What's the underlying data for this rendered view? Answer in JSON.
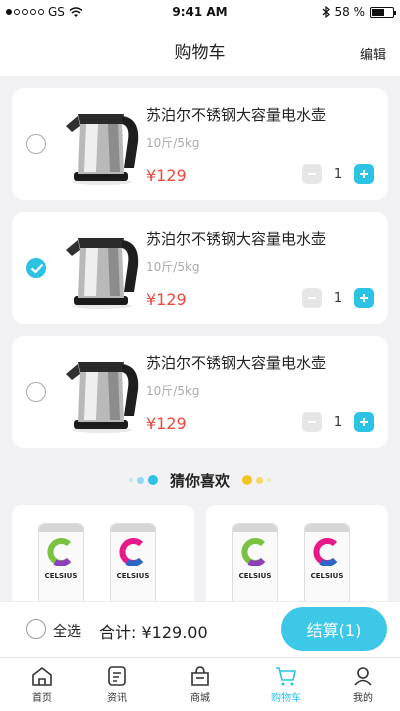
{
  "status_bar": {
    "carrier": "GS",
    "time": "9:41 AM",
    "battery": "58 %",
    "battery_level": 0.58
  },
  "nav": {
    "title": "购物车",
    "edit_label": "编辑"
  },
  "cart_items": [
    {
      "name": "苏泊尔不锈钢大容量电水壶",
      "spec": "10斤/5kg",
      "price": "¥129",
      "quantity": "1",
      "checked": false
    },
    {
      "name": "苏泊尔不锈钢大容量电水壶",
      "spec": "10斤/5kg",
      "price": "¥129",
      "quantity": "1",
      "checked": true
    },
    {
      "name": "苏泊尔不锈钢大容量电水壶",
      "spec": "10斤/5kg",
      "price": "¥129",
      "quantity": "1",
      "checked": false
    }
  ],
  "recommend": {
    "title": "猜你喜欢",
    "products": [
      {
        "brand": "CELSIUS"
      },
      {
        "brand": "CELSIUS"
      }
    ]
  },
  "checkout": {
    "select_all_label": "全选",
    "total_label": "合计: ¥129.00",
    "button_label": "结算(1)"
  },
  "tabs": [
    {
      "label": "首页",
      "icon": "home-icon",
      "active": false
    },
    {
      "label": "资讯",
      "icon": "news-icon",
      "active": false
    },
    {
      "label": "商城",
      "icon": "store-icon",
      "active": false
    },
    {
      "label": "购物车",
      "icon": "cart-icon",
      "active": true
    },
    {
      "label": "我的",
      "icon": "profile-icon",
      "active": false
    }
  ],
  "colors": {
    "accent": "#2cc2e4",
    "price": "#f0483c",
    "background": "#f2f2f4"
  }
}
